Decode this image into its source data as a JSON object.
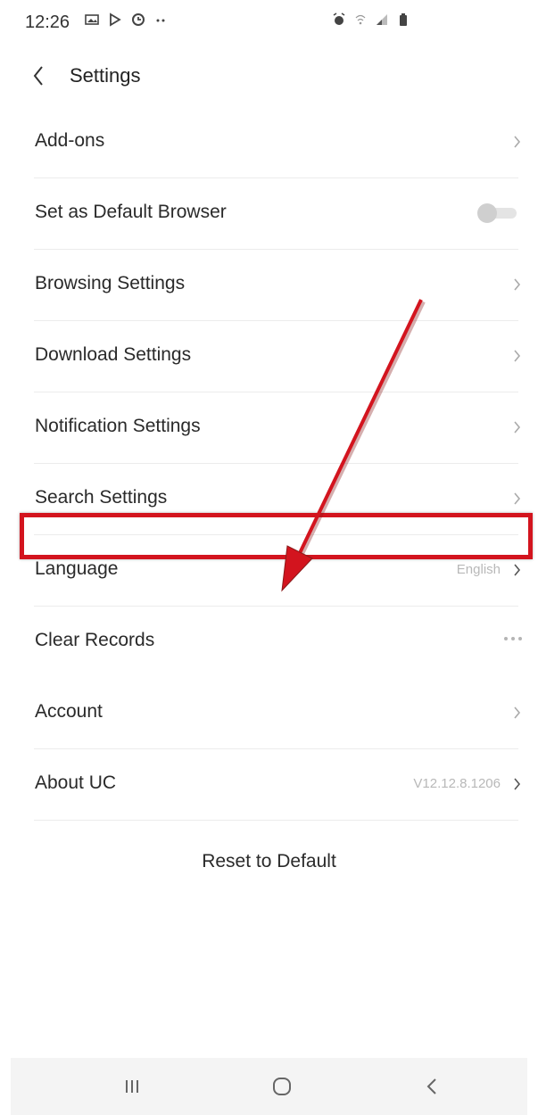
{
  "status_bar": {
    "time": "12:26",
    "left_icons": [
      "gallery-icon",
      "play-store-icon",
      "sync-icon",
      "more-notifications-icon"
    ],
    "right_icons": [
      "alarm-icon",
      "wifi-calling-icon",
      "signal-icon",
      "battery-icon"
    ]
  },
  "header": {
    "back_icon": "chevron-left-icon",
    "title": "Settings"
  },
  "settings": {
    "items": [
      {
        "label": "Add-ons",
        "trailing": "chevron"
      },
      {
        "label": "Set as Default Browser",
        "trailing": "toggle",
        "toggle_on": false
      },
      {
        "label": "Browsing Settings",
        "trailing": "chevron"
      },
      {
        "label": "Download Settings",
        "trailing": "chevron"
      },
      {
        "label": "Notification Settings",
        "trailing": "chevron"
      },
      {
        "label": "Search Settings",
        "trailing": "chevron"
      },
      {
        "label": "Language",
        "trailing": "chevron",
        "value": "English"
      },
      {
        "label": "Clear Records",
        "trailing": "more"
      },
      {
        "label": "Account",
        "trailing": "chevron"
      },
      {
        "label": "About UC",
        "trailing": "chevron",
        "value": "V12.12.8.1206"
      }
    ],
    "reset_label": "Reset to Default"
  },
  "annotation": {
    "color": "#d3141e",
    "highlighted_item": "Clear Records"
  },
  "nav_bar": {
    "buttons": [
      "recent-apps-icon",
      "home-icon",
      "back-icon"
    ]
  }
}
